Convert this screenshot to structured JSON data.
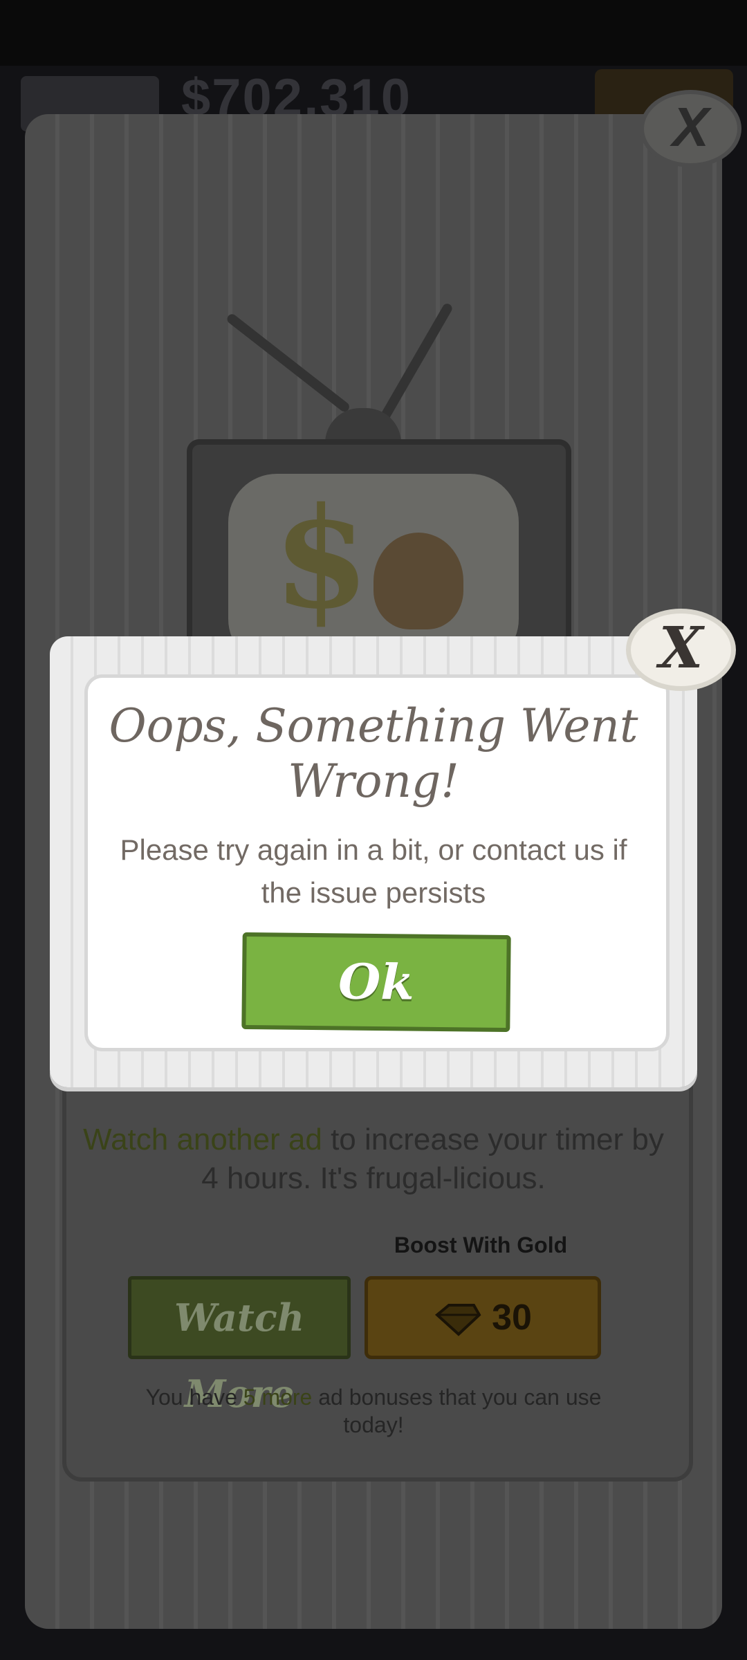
{
  "hud": {
    "money": "$702,310"
  },
  "ad_panel": {
    "message_highlight": "Watch another ad",
    "message_rest": " to increase your timer by 4 hours. It's frugal-licious.",
    "boost_label": "Boost With Gold",
    "watch_button_label": "Watch More",
    "gold_cost": "30",
    "bonus_prefix": "You have ",
    "bonus_highlight": "5 more",
    "bonus_suffix": " ad bonuses that you can use today!",
    "close_label": "X"
  },
  "error_dialog": {
    "title": "Oops, Something Went Wrong!",
    "message": "Please try again in a bit, or contact us if the issue persists",
    "ok_label": "Ok",
    "close_label": "X"
  },
  "colors": {
    "ok_green": "#7ab342",
    "gold": "#5a4412",
    "frame": "#ececec"
  },
  "icons": {
    "close": "close-icon",
    "gem": "gem-icon"
  }
}
